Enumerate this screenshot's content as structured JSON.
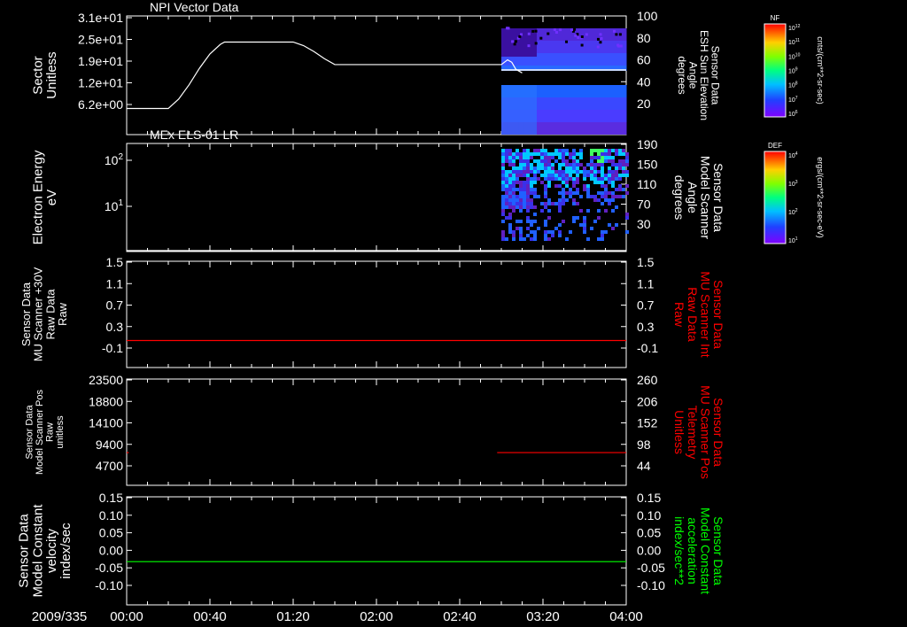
{
  "colors": {
    "background": "#000000",
    "axis": "#ffffff",
    "red_trace": "#ff0000",
    "green_trace": "#00ff00",
    "white_trace": "#ffffff"
  },
  "x_axis": {
    "date_label": "2009/335",
    "ticks": [
      "00:00",
      "00:40",
      "01:20",
      "02:00",
      "02:40",
      "03:20",
      "04:00"
    ],
    "range_minutes": [
      0,
      240
    ]
  },
  "colorbars": [
    {
      "tag": "NF",
      "units": "cnts/(cm**2-sr-sec)",
      "tick_labels": [
        "10^12",
        "10^11",
        "10^10",
        "10^9",
        "10^8",
        "10^7",
        "10^6"
      ]
    },
    {
      "tag": "DEF",
      "units": "ergs/(cm**2-sr-sec-eV)",
      "tick_labels": [
        "10^4",
        "10^3",
        "10^2",
        "10^1"
      ]
    }
  ],
  "chart_data": [
    {
      "id": "p1",
      "type": "line",
      "title": "NPI Vector Data",
      "ylabel_left": [
        "Sector",
        "Unitless"
      ],
      "ylabel_right": [
        "Sensor Data",
        "ESH Sun Elevation",
        "Angle",
        "degrees"
      ],
      "yticks_left": [
        "3.1e+01",
        "2.5e+01",
        "1.9e+01",
        "1.2e+01",
        "6.2e+00"
      ],
      "yticks_right": [
        "100",
        "80",
        "60",
        "40",
        "20"
      ],
      "ylim_right": [
        0,
        100
      ],
      "series": [
        {
          "color": "#ffffff",
          "x_minutes": [
            0,
            20,
            25,
            30,
            35,
            40,
            45,
            47,
            70,
            80,
            85,
            90,
            95,
            100,
            180,
            183,
            185,
            187,
            190
          ],
          "y": [
            22,
            22,
            30,
            42,
            56,
            68,
            76,
            78,
            78,
            78,
            75,
            70,
            64,
            59,
            59,
            63,
            61,
            55,
            52
          ]
        }
      ],
      "spectrogram": {
        "colorbar": 0,
        "x_start_minutes": 180,
        "x_end_minutes": 240
      }
    },
    {
      "id": "p2",
      "type": "heatmap",
      "title": "MEx ELS-01 LR",
      "ylabel_left": [
        "Electron Energy",
        "eV"
      ],
      "ylabel_right": [
        "Sensor Data",
        "Model Scanner",
        "Angle",
        "degrees"
      ],
      "yticks_left": [
        "10^2",
        "10^1"
      ],
      "yticks_right": [
        "190",
        "150",
        "110",
        "70",
        "30"
      ],
      "ylim_right": [
        10,
        190
      ],
      "series": [
        {
          "color": "#ffffff",
          "x_minutes": [
            0,
            240
          ],
          "y": [
            10,
            10
          ]
        }
      ],
      "spectrogram": {
        "colorbar": 1,
        "x_start_minutes": 180,
        "x_end_minutes": 240
      }
    },
    {
      "id": "p3",
      "type": "line",
      "title": "",
      "ylabel_left": [
        "Sensor Data",
        "MU Scanner +30V",
        "Raw Data",
        "Raw"
      ],
      "ylabel_right": [
        "Sensor Data",
        "MU Scanner Int",
        "Raw Data",
        "Raw"
      ],
      "ylabel_right_color": "#ff0000",
      "yticks_left": [
        "1.5",
        "1.1",
        "0.7",
        "0.3",
        "-0.1"
      ],
      "yticks_right": [
        "1.5",
        "1.1",
        "0.7",
        "0.3",
        "-0.1"
      ],
      "ylim": [
        -0.5,
        1.5
      ],
      "series": [
        {
          "color": "#ff0000",
          "x_minutes": [
            0,
            240
          ],
          "y": [
            0,
            0
          ]
        }
      ]
    },
    {
      "id": "p4",
      "type": "line",
      "title": "",
      "ylabel_left": [
        "Sensor Data",
        "Model Scanner Pos",
        "Raw",
        "unitless"
      ],
      "ylabel_right": [
        "Sensor Data",
        "MU Scanner Pos",
        "Telemetry",
        "Unitless"
      ],
      "ylabel_right_color": "#ff0000",
      "yticks_left": [
        "23500",
        "18800",
        "14100",
        "9400",
        "4700"
      ],
      "yticks_right": [
        "260",
        "206",
        "152",
        "98",
        "44"
      ],
      "ylim_right": [
        0,
        260
      ],
      "series": [
        {
          "color": "#ff0000",
          "x_minutes": [
            0,
            1
          ],
          "y": [
            80,
            80
          ]
        },
        {
          "color": "#ff0000",
          "x_minutes": [
            178,
            240
          ],
          "y": [
            80,
            80
          ]
        }
      ]
    },
    {
      "id": "p5",
      "type": "line",
      "title": "",
      "ylabel_left": [
        "Sensor Data",
        "Model Constant",
        "velocity",
        "index/sec"
      ],
      "ylabel_right": [
        "Sensor Data",
        "Model Constant",
        "acceleration",
        "index/sec**2"
      ],
      "ylabel_right_color": "#00ff00",
      "yticks_left": [
        "0.15",
        "0.10",
        "0.05",
        "0.00",
        "-0.05",
        "-0.10"
      ],
      "yticks_right": [
        "0.15",
        "0.10",
        "0.05",
        "0.00",
        "-0.05",
        "-0.10"
      ],
      "ylim": [
        -0.1,
        0.15
      ],
      "series": [
        {
          "color": "#00ff00",
          "x_minutes": [
            0,
            240
          ],
          "y": [
            0,
            0
          ]
        }
      ]
    }
  ]
}
